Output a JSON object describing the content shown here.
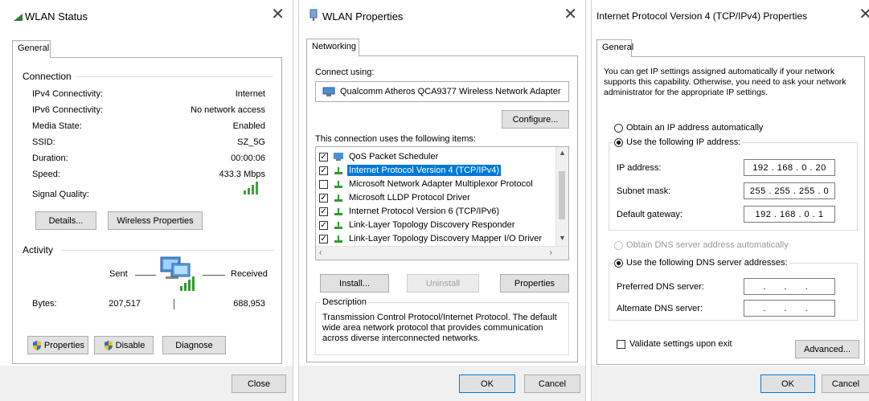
{
  "status": {
    "title": "WLAN Status",
    "tab": "General",
    "connection_group": "Connection",
    "rows": [
      {
        "label": "IPv4 Connectivity:",
        "value": "Internet"
      },
      {
        "label": "IPv6 Connectivity:",
        "value": "No network access"
      },
      {
        "label": "Media State:",
        "value": "Enabled"
      },
      {
        "label": "SSID:",
        "value": "SZ_5G"
      },
      {
        "label": "Duration:",
        "value": "00:00:06"
      },
      {
        "label": "Speed:",
        "value": "433.3 Mbps"
      }
    ],
    "signal_label": "Signal Quality:",
    "details_btn": "Details...",
    "wireless_btn": "Wireless Properties",
    "activity_group": "Activity",
    "sent_label": "Sent",
    "received_label": "Received",
    "bytes_label": "Bytes:",
    "bytes_sent": "207,517",
    "bytes_received": "688,953",
    "properties_btn": "Properties",
    "disable_btn": "Disable",
    "diagnose_btn": "Diagnose",
    "close_btn": "Close"
  },
  "props": {
    "title": "WLAN Properties",
    "tab": "Networking",
    "connect_using": "Connect using:",
    "adapter": "Qualcomm Atheros QCA9377 Wireless Network Adapter",
    "configure_btn": "Configure...",
    "items_label": "This connection uses the following items:",
    "items": [
      {
        "label": "QoS Packet Scheduler",
        "checked": true
      },
      {
        "label": "Internet Protocol Version 4 (TCP/IPv4)",
        "checked": true
      },
      {
        "label": "Microsoft Network Adapter Multiplexor Protocol",
        "checked": false
      },
      {
        "label": "Microsoft LLDP Protocol Driver",
        "checked": true
      },
      {
        "label": "Internet Protocol Version 6 (TCP/IPv6)",
        "checked": true
      },
      {
        "label": "Link-Layer Topology Discovery Responder",
        "checked": true
      },
      {
        "label": "Link-Layer Topology Discovery Mapper I/O Driver",
        "checked": true
      }
    ],
    "install_btn": "Install...",
    "uninstall_btn": "Uninstall",
    "properties_btn": "Properties",
    "description_group": "Description",
    "description_text": "Transmission Control Protocol/Internet Protocol. The default wide area network protocol that provides communication across diverse interconnected networks.",
    "ok_btn": "OK",
    "cancel_btn": "Cancel"
  },
  "ipv4": {
    "title": "Internet Protocol Version 4 (TCP/IPv4) Properties",
    "tab": "General",
    "intro": "You can get IP settings assigned automatically if your network supports this capability. Otherwise, you need to ask your network administrator for the appropriate IP settings.",
    "obtain_ip": "Obtain an IP address automatically",
    "use_ip": "Use the following IP address:",
    "ip_label": "IP address:",
    "ip_value": "192 . 168 . 0 . 20",
    "mask_label": "Subnet mask:",
    "mask_value": "255 . 255 . 255 . 0",
    "gateway_label": "Default gateway:",
    "gateway_value": "192 . 168 . 0 . 1",
    "obtain_dns": "Obtain DNS server address automatically",
    "use_dns": "Use the following DNS server addresses:",
    "preferred_label": "Preferred DNS server:",
    "preferred_value": ". . .",
    "alternate_label": "Alternate DNS server:",
    "alternate_value": ". . .",
    "validate": "Validate settings upon exit",
    "advanced_btn": "Advanced...",
    "ok_btn": "OK",
    "cancel_btn": "Cancel"
  }
}
